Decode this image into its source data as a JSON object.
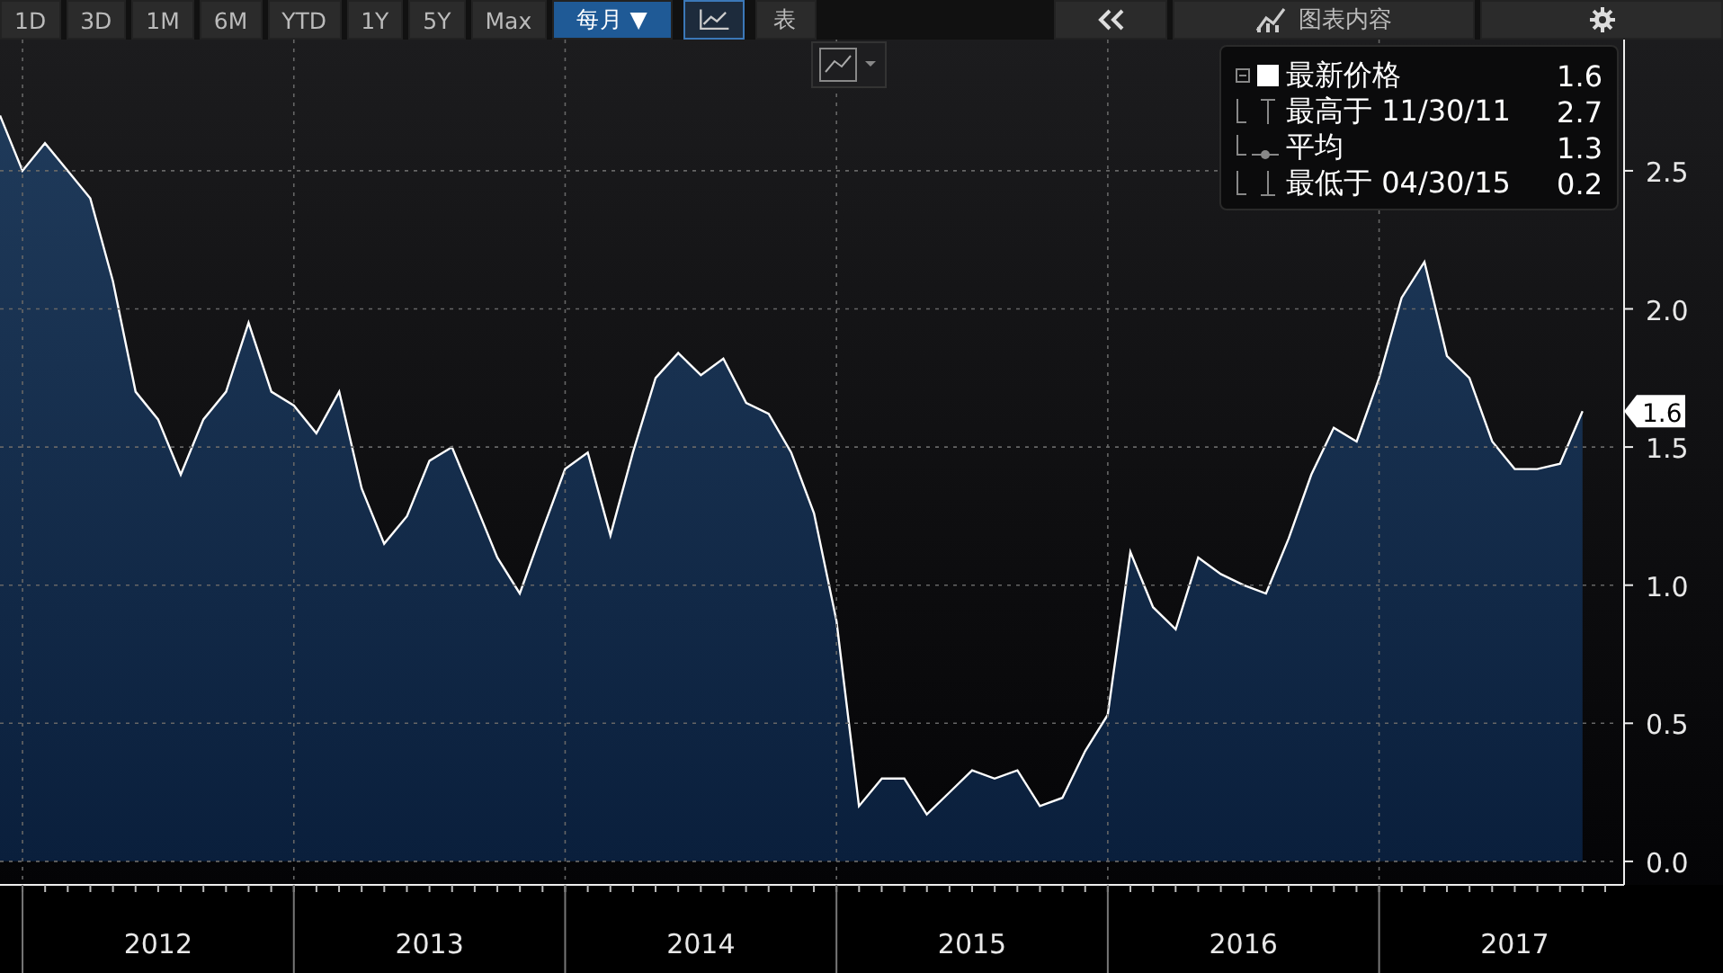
{
  "toolbar": {
    "ranges": [
      {
        "label": "1D",
        "selected": false
      },
      {
        "label": "3D",
        "selected": false
      },
      {
        "label": "1M",
        "selected": false
      },
      {
        "label": "6M",
        "selected": false
      },
      {
        "label": "YTD",
        "selected": false
      },
      {
        "label": "1Y",
        "selected": false
      },
      {
        "label": "5Y",
        "selected": false
      },
      {
        "label": "Max",
        "selected": false
      }
    ],
    "period": {
      "label": "每月 ▼",
      "selected": true
    },
    "views": [
      {
        "kind": "chart",
        "selected": true
      },
      {
        "kind": "table",
        "label": "表",
        "selected": false
      }
    ],
    "panel_button": {
      "label": "图表内容"
    }
  },
  "chart": {
    "legend": [
      {
        "kind": "last",
        "value": "1.6"
      },
      {
        "kind": "high",
        "label": "最高于 11/30/11",
        "value": "2.7"
      },
      {
        "kind": "average",
        "label": "平均",
        "value": "1.3"
      },
      {
        "kind": "low",
        "label": "最低于 04/30/15",
        "value": "0.2"
      }
    ],
    "current_value_label": "1.6",
    "chart_data": {
      "type": "area",
      "grid": true,
      "x": [
        2011.917,
        2012.0,
        2012.083,
        2012.167,
        2012.25,
        2012.333,
        2012.417,
        2012.5,
        2012.583,
        2012.667,
        2012.75,
        2012.833,
        2012.917,
        2013.0,
        2013.083,
        2013.167,
        2013.25,
        2013.333,
        2013.417,
        2013.5,
        2013.583,
        2013.667,
        2013.75,
        2013.833,
        2013.917,
        2014.0,
        2014.083,
        2014.167,
        2014.25,
        2014.333,
        2014.417,
        2014.5,
        2014.583,
        2014.667,
        2014.75,
        2014.833,
        2014.917,
        2015.0,
        2015.083,
        2015.167,
        2015.25,
        2015.333,
        2015.417,
        2015.5,
        2015.583,
        2015.667,
        2015.75,
        2015.833,
        2015.917,
        2016.0,
        2016.083,
        2016.167,
        2016.25,
        2016.333,
        2016.417,
        2016.5,
        2016.583,
        2016.667,
        2016.75,
        2016.833,
        2016.917,
        2017.0,
        2017.083,
        2017.167,
        2017.25,
        2017.333,
        2017.417,
        2017.5,
        2017.583,
        2017.667,
        2017.75
      ],
      "series": [
        {
          "name": "最新价格",
          "color": "#ffffff",
          "values": [
            2.7,
            2.5,
            2.6,
            2.5,
            2.4,
            2.1,
            1.7,
            1.6,
            1.4,
            1.6,
            1.7,
            1.95,
            1.7,
            1.65,
            1.55,
            1.7,
            1.35,
            1.15,
            1.25,
            1.45,
            1.5,
            1.3,
            1.1,
            0.97,
            1.2,
            1.42,
            1.48,
            1.18,
            1.48,
            1.75,
            1.84,
            1.76,
            1.82,
            1.66,
            1.62,
            1.48,
            1.26,
            0.87,
            0.2,
            0.3,
            0.3,
            0.17,
            0.25,
            0.33,
            0.3,
            0.33,
            0.2,
            0.23,
            0.4,
            0.53,
            1.12,
            0.92,
            0.84,
            1.1,
            1.04,
            1.0,
            0.97,
            1.17,
            1.4,
            1.57,
            1.52,
            1.75,
            2.04,
            2.17,
            1.83,
            1.75,
            1.52,
            1.42,
            1.42,
            1.44,
            1.63
          ]
        }
      ],
      "xlim": [
        2011.917,
        2017.883
      ],
      "ylim": [
        -0.085,
        2.975
      ],
      "xticks": [
        {
          "value": 2012.5,
          "label": "2012"
        },
        {
          "value": 2013.5,
          "label": "2013"
        },
        {
          "value": 2014.5,
          "label": "2014"
        },
        {
          "value": 2015.5,
          "label": "2015"
        },
        {
          "value": 2016.5,
          "label": "2016"
        },
        {
          "value": 2017.5,
          "label": "2017"
        }
      ],
      "yticks": [
        {
          "value": 0,
          "label": "0.0"
        },
        {
          "value": 0.5,
          "label": "0.5"
        },
        {
          "value": 1,
          "label": "1.0"
        },
        {
          "value": 1.5,
          "label": "1.5"
        },
        {
          "value": 2,
          "label": "2.0"
        },
        {
          "value": 2.5,
          "label": "2.5"
        }
      ]
    }
  }
}
